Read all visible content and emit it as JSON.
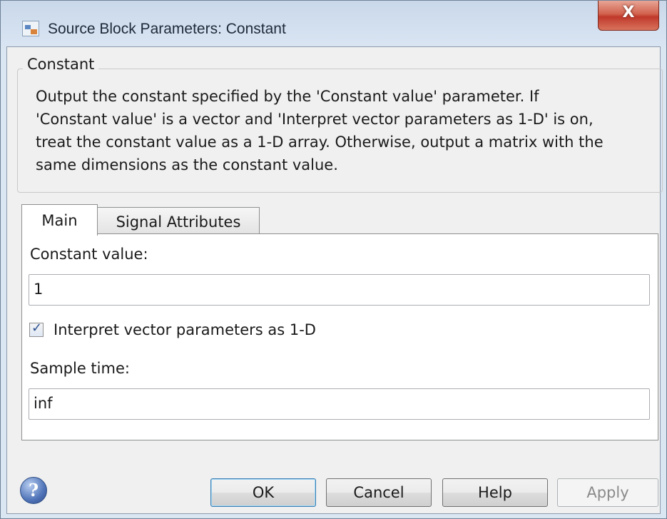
{
  "window": {
    "title": "Source Block Parameters: Constant",
    "close_label": "X"
  },
  "group": {
    "legend": "Constant",
    "description_lines": [
      "Output the constant specified by the 'Constant value' parameter. If",
      "'Constant value' is a vector and 'Interpret vector parameters as 1-D' is on,",
      "treat the constant value as a 1-D array. Otherwise, output a matrix with the",
      "same dimensions as the constant value."
    ]
  },
  "tabs": [
    {
      "label": "Main",
      "active": true
    },
    {
      "label": "Signal Attributes",
      "active": false
    }
  ],
  "main": {
    "constant_value_label": "Constant value:",
    "constant_value": "1",
    "interpret_checkbox_label": "Interpret vector parameters as 1-D",
    "interpret_checked": true,
    "sample_time_label": "Sample time:",
    "sample_time": "inf"
  },
  "buttons": {
    "help_icon": "question-mark-icon",
    "ok": "OK",
    "cancel": "Cancel",
    "help": "Help",
    "apply": "Apply"
  }
}
